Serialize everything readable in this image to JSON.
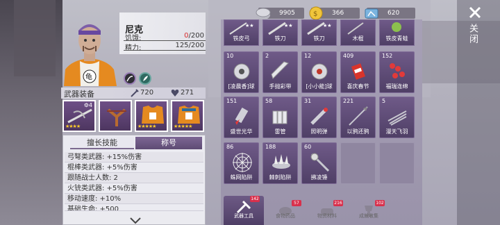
{
  "character": {
    "name": "尼克",
    "hunger_label": "饥饿:",
    "hunger_current": "0",
    "hunger_max": "/200",
    "stamina_label": "精力:",
    "stamina_value": "125/200"
  },
  "equipment": {
    "title": "武器装备",
    "attack": "720",
    "defense": "271",
    "slots": [
      {
        "icon": "crossbow-icon",
        "stars": "★★★★",
        "gear": "⚙4"
      },
      {
        "icon": "slingshot-icon",
        "stars": ""
      },
      {
        "icon": "armor-vest-icon",
        "stars": "★★★★★"
      },
      {
        "icon": "armor-vest-icon",
        "stars": "★★★★★"
      }
    ]
  },
  "skills": {
    "tab_skills": "擅长技能",
    "tab_title": "称号",
    "items": [
      "弓弩类武器: +15%伤害",
      "棍棒类武器: +5%伤害",
      "跟随战士人数: 2",
      "火铳类武器: +5%伤害",
      "移动速度: +10%",
      "基础生命: +500"
    ]
  },
  "currency": {
    "silver": "9905",
    "gold": "366",
    "tickets": "620"
  },
  "inventory": {
    "top_row": [
      {
        "name": "铁皮弓",
        "stars": "★★"
      },
      {
        "name": "铁刀",
        "stars": "★★"
      },
      {
        "name": "铁刀",
        "stars": "★★"
      },
      {
        "name": "木棍",
        "stars": ""
      },
      {
        "name": "铁皮青蛙",
        "stars": ""
      }
    ],
    "rows": [
      [
        {
          "count": "10",
          "name": "[凌晨香]球",
          "icon": "bomb-icon"
        },
        {
          "count": "2",
          "name": "手抛彩带",
          "icon": "drill-icon"
        },
        {
          "count": "12",
          "name": "[小小能]球",
          "icon": "bomb-icon"
        },
        {
          "count": "409",
          "name": "喜庆春节",
          "icon": "firecracker-icon"
        },
        {
          "count": "152",
          "name": "福瑞连绵",
          "icon": "firecracker-string-icon"
        }
      ],
      [
        {
          "count": "151",
          "name": "盛世光华",
          "icon": "rocket-icon"
        },
        {
          "count": "58",
          "name": "雷管",
          "icon": "dynamite-icon"
        },
        {
          "count": "31",
          "name": "照明弹",
          "icon": "flare-icon"
        },
        {
          "count": "221",
          "name": "以鸦还鸦",
          "icon": "dart-icon"
        },
        {
          "count": "5",
          "name": "漫天飞羽",
          "icon": "feather-darts-icon"
        }
      ],
      [
        {
          "count": "86",
          "name": "蛛网陷阱",
          "icon": "web-trap-icon"
        },
        {
          "count": "188",
          "name": "棘刺陷阱",
          "icon": "spike-trap-icon"
        },
        {
          "count": "60",
          "name": "拂凌锤",
          "icon": "hammer-icon"
        }
      ]
    ]
  },
  "categories": [
    {
      "label": "武器工具",
      "badge": "142",
      "icon": "tools-icon"
    },
    {
      "label": "食物药品",
      "badge": "57",
      "icon": "food-icon"
    },
    {
      "label": "物资材料",
      "badge": "216",
      "icon": "materials-icon"
    },
    {
      "label": "成就收集",
      "badge": "102",
      "icon": "trophy-icon"
    }
  ],
  "close_label": "关闭"
}
